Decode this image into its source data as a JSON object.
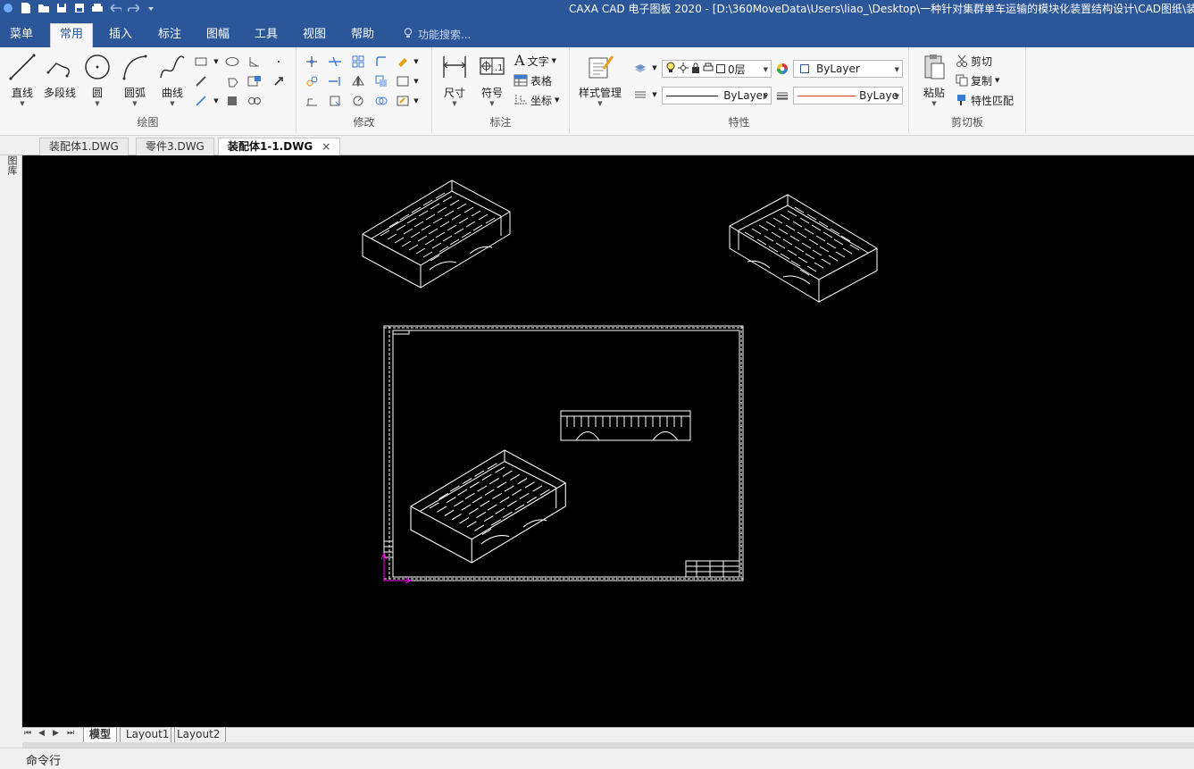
{
  "window": {
    "title": "CAXA CAD 电子图板 2020 - [D:\\360MoveData\\Users\\liao_\\Desktop\\一种针对集群单车运输的模块化装置结构设计\\CAD图纸\\装配"
  },
  "ribbon_tabs": [
    "菜单",
    "常用",
    "插入",
    "标注",
    "图幅",
    "工具",
    "视图",
    "帮助"
  ],
  "active_ribbon_tab": "常用",
  "search": {
    "placeholder": "功能搜索..."
  },
  "groups": {
    "draw": {
      "label": "绘图",
      "buttons": [
        "直线",
        "多段线",
        "圆",
        "圆弧",
        "曲线"
      ]
    },
    "modify": {
      "label": "修改"
    },
    "annotate": {
      "label": "标注",
      "dimension": "尺寸",
      "symbol": "符号",
      "text": "文字",
      "table": "表格",
      "coord": "坐标"
    },
    "properties": {
      "label": "特性",
      "style_manager": "样式管理",
      "layer": "0层",
      "color": "ByLayer",
      "linetype": "ByLayer",
      "lineweight": "ByLaye"
    },
    "clipboard": {
      "label": "剪切板",
      "paste": "粘贴",
      "cut": "剪切",
      "copy": "复制",
      "match": "特性匹配"
    }
  },
  "doc_tabs": [
    {
      "label": "装配体1.DWG",
      "active": false
    },
    {
      "label": "零件3.DWG",
      "active": false
    },
    {
      "label": "装配体1-1.DWG",
      "active": true
    }
  ],
  "doc_close": "×",
  "left_panel_label": "图库",
  "layout_tabs": [
    {
      "label": "模型",
      "active": true
    },
    {
      "label": "Layout1",
      "active": false
    },
    {
      "label": "Layout2",
      "active": false
    }
  ],
  "nav_glyphs": [
    "⏮",
    "◀",
    "▶",
    "⏭"
  ],
  "command_line": "命令行",
  "colors": {
    "titlebar": "#2b579a",
    "ribbon_bg": "#f7f7f7",
    "canvas_bg": "#000000",
    "linetype_red": "#e03030",
    "ucs_magenta": "#ff00ff"
  }
}
